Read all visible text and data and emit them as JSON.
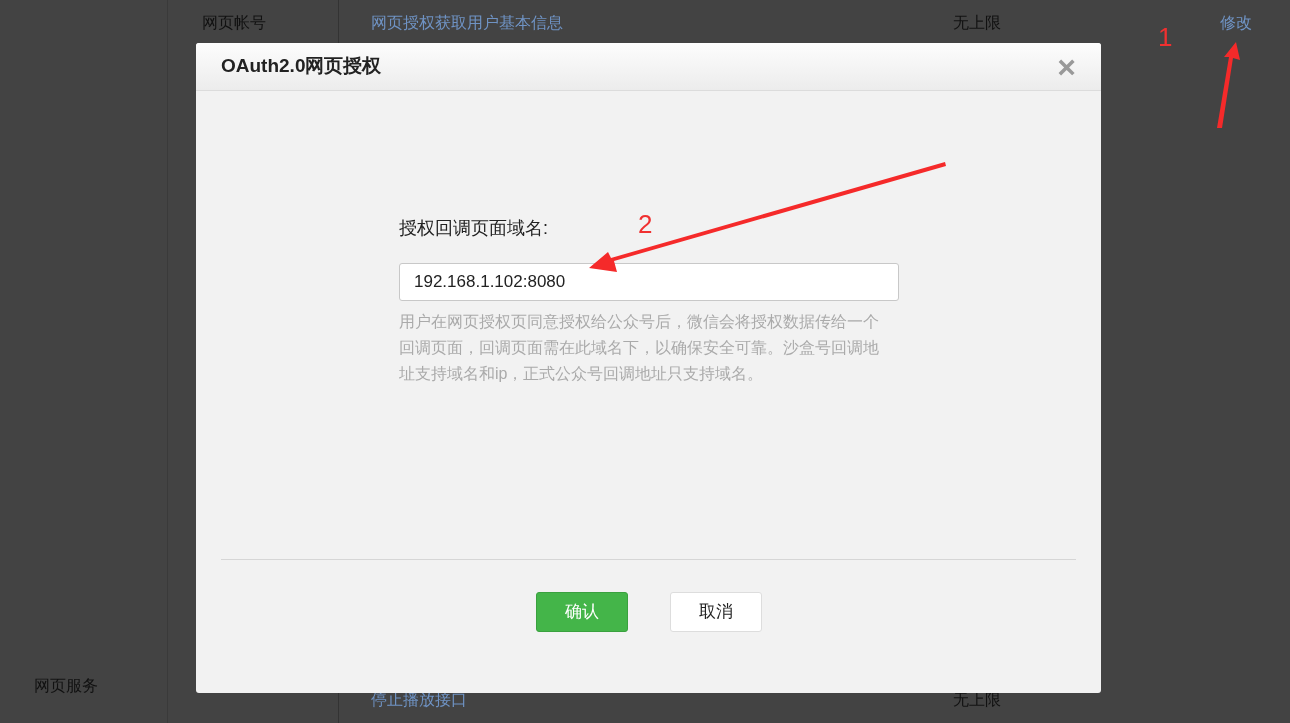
{
  "sidebar": {
    "items": [
      "网页服务"
    ]
  },
  "table": {
    "rows": [
      {
        "label": "网页帐号",
        "name": "网页授权获取用户基本信息",
        "limit": "无上限",
        "action": "修改"
      },
      {
        "label": "",
        "name": "停止播放接口",
        "limit": "无上限",
        "action": ""
      }
    ]
  },
  "dialog": {
    "title": "OAuth2.0网页授权",
    "close": "×",
    "field_label": "授权回调页面域名:",
    "value": "192.168.1.102:8080",
    "hint": "用户在网页授权页同意授权给公众号后，微信会将授权数据传给一个回调页面，回调页面需在此域名下，以确保安全可靠。沙盒号回调地址支持域名和ip，正式公众号回调地址只支持域名。",
    "buttons": [
      {
        "label": "确认",
        "kind": "primary"
      },
      {
        "label": "取消",
        "kind": "secondary"
      }
    ]
  },
  "annotations": [
    "1",
    "2"
  ]
}
